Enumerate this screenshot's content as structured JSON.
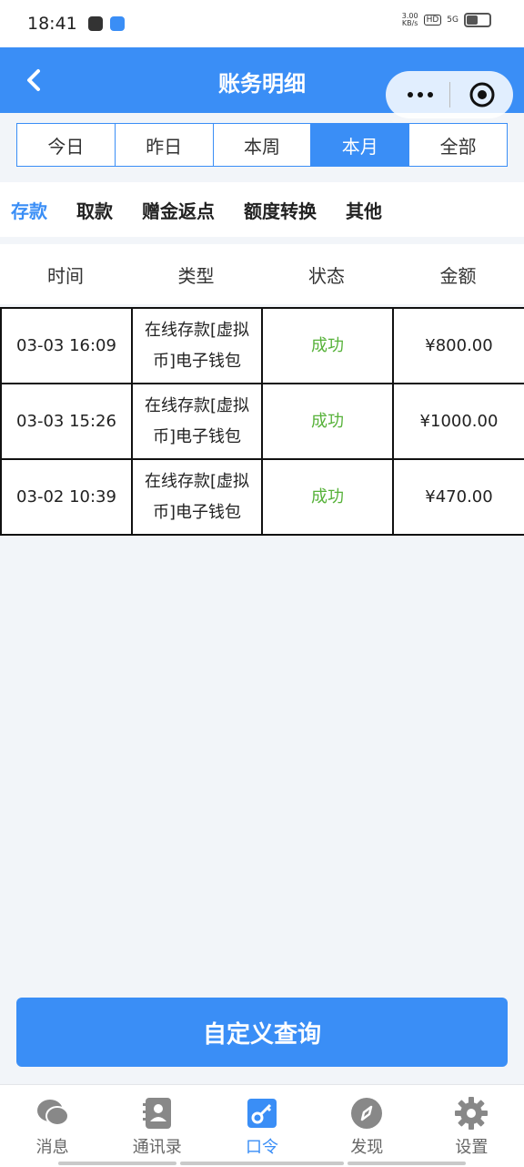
{
  "status_bar": {
    "time": "18:41",
    "net_speed_value": "3.00",
    "net_speed_unit": "KB/s",
    "hd_label": "HD",
    "signal_label": "5G"
  },
  "nav": {
    "title": "账务明细",
    "back_icon": "chevron-left-icon",
    "more_icon": "more-dots-icon",
    "close_icon": "target-circle-icon"
  },
  "period_tabs": [
    {
      "label": "今日",
      "active": false
    },
    {
      "label": "昨日",
      "active": false
    },
    {
      "label": "本周",
      "active": false
    },
    {
      "label": "本月",
      "active": true
    },
    {
      "label": "全部",
      "active": false
    }
  ],
  "type_tabs": [
    {
      "label": "存款",
      "active": true
    },
    {
      "label": "取款",
      "active": false
    },
    {
      "label": "赠金返点",
      "active": false
    },
    {
      "label": "额度转换",
      "active": false
    },
    {
      "label": "其他",
      "active": false
    }
  ],
  "table": {
    "headers": [
      "时间",
      "类型",
      "状态",
      "金额"
    ],
    "rows": [
      {
        "time": "03-03 16:09",
        "type": "在线存款[虚拟币]电子钱包",
        "status": "成功",
        "amount": "¥800.00"
      },
      {
        "time": "03-03 15:26",
        "type": "在线存款[虚拟币]电子钱包",
        "status": "成功",
        "amount": "¥1000.00"
      },
      {
        "time": "03-02 10:39",
        "type": "在线存款[虚拟币]电子钱包",
        "status": "成功",
        "amount": "¥470.00"
      }
    ]
  },
  "query_button": {
    "label": "自定义查询"
  },
  "bottom_nav": [
    {
      "label": "消息",
      "icon": "chat-bubble-icon",
      "active": false
    },
    {
      "label": "通讯录",
      "icon": "contacts-book-icon",
      "active": false
    },
    {
      "label": "口令",
      "icon": "key-icon",
      "active": true
    },
    {
      "label": "发现",
      "icon": "compass-icon",
      "active": false
    },
    {
      "label": "设置",
      "icon": "gear-icon",
      "active": false
    }
  ],
  "colors": {
    "primary": "#3a8ef6",
    "success": "#57b23a",
    "background": "#f2f5f9"
  }
}
